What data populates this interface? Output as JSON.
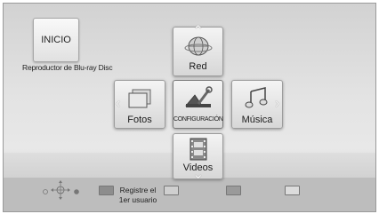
{
  "home": {
    "title": "INICIO",
    "subtitle": "Reproductor de Blu-ray Disc"
  },
  "menu": {
    "red": {
      "label": "Red",
      "icon": "network-globe-icon"
    },
    "fotos": {
      "label": "Fotos",
      "icon": "photos-icon"
    },
    "config": {
      "label": "CONFIGURACIÓN",
      "icon": "settings-tools-icon"
    },
    "musica": {
      "label": "Música",
      "icon": "music-notes-icon"
    },
    "videos": {
      "label": "Videos",
      "icon": "film-strip-icon"
    }
  },
  "footer": {
    "nav_icon": "navigation-pad-icon",
    "buttons": [
      {
        "color": "#8d8d8d",
        "label_line1": "Registre el",
        "label_line2": "1er usuario"
      },
      {
        "color": "#cfcfcf",
        "label_line1": "",
        "label_line2": ""
      },
      {
        "color": "#9a9a9a",
        "label_line1": "",
        "label_line2": ""
      },
      {
        "color": "#dcdcdc",
        "label_line1": "",
        "label_line2": ""
      }
    ]
  }
}
